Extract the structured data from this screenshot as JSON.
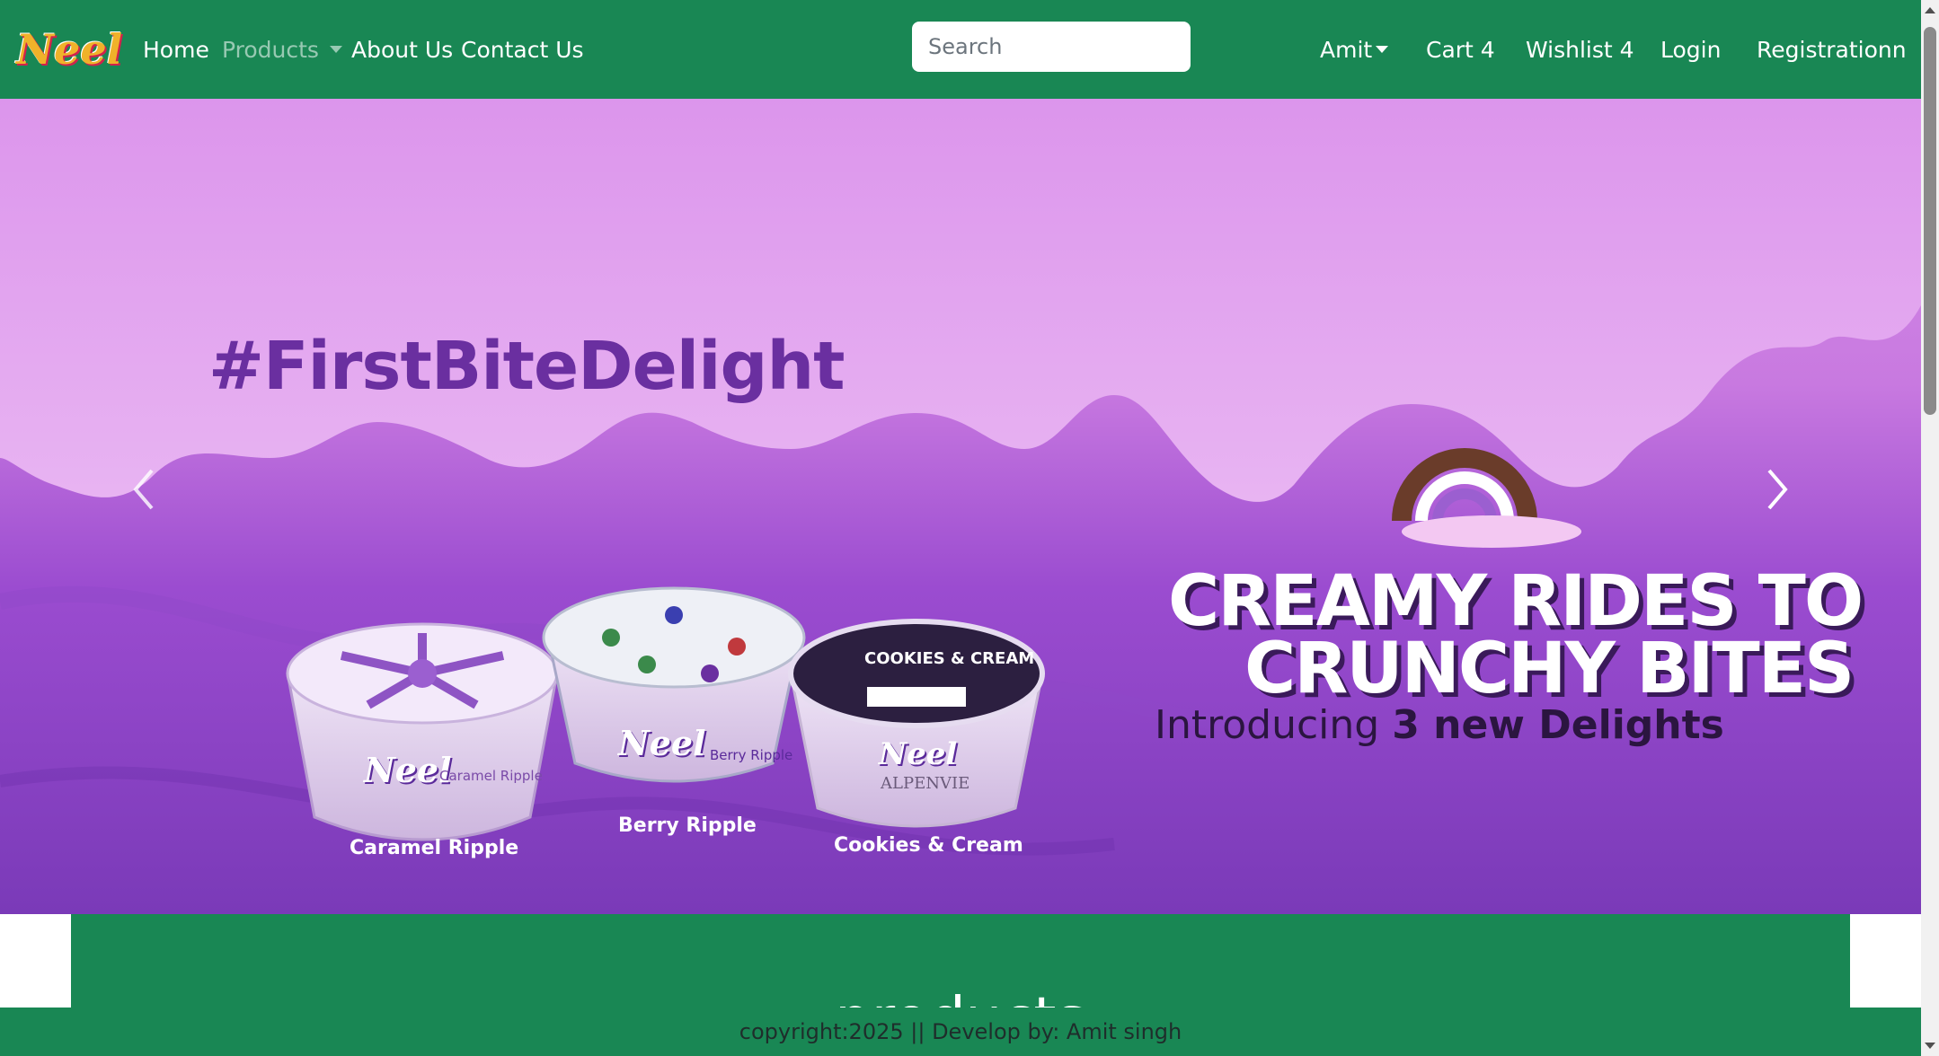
{
  "navbar": {
    "brand": "Neel",
    "links": {
      "home": "Home",
      "products": "Products",
      "about": "About Us",
      "contact": "Contact Us"
    },
    "search_placeholder": "Search",
    "user": "Amit",
    "cart": "Cart 4",
    "wishlist": "Wishlist 4",
    "login": "Login",
    "registration": "Registrationn"
  },
  "banner": {
    "hashtag": "#FirstBiteDelight",
    "headline_line1": "CREAMY RIDES TO",
    "headline_line2": "CRUNCHY BITES",
    "subline_prefix": "Introducing ",
    "subline_bold": "3 new Delights",
    "products": [
      {
        "name": "Caramel Ripple",
        "lid_text": "Caramel Ripple"
      },
      {
        "name": "Berry Ripple",
        "lid_text": "Berry Ripple"
      },
      {
        "name": "Cookies & Cream",
        "lid_text": "COOKIES & CREAM",
        "sub_brand": "ALPENVIE"
      }
    ],
    "brand_on_cups": "Neel"
  },
  "products_section": {
    "heading": "products"
  },
  "footer": {
    "text": "copyright:2025 || Develop by: Amit singh"
  },
  "colors": {
    "navbar": "#198754",
    "banner_top": "#d78fe8",
    "banner_bottom": "#7a3ab8",
    "headline": "#ffffff",
    "hashtag": "#6a2fa0"
  },
  "icons": {
    "prev": "chevron-left-icon",
    "next": "chevron-right-icon",
    "caret": "caret-down-icon"
  }
}
